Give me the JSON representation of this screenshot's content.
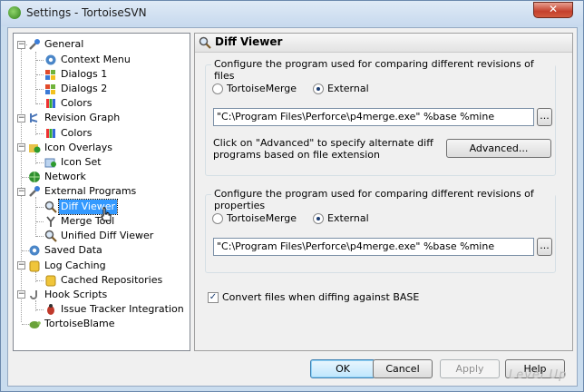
{
  "window": {
    "title": "Settings - TortoiseSVN",
    "close_glyph": "✕"
  },
  "tree": {
    "nodes": [
      {
        "label": "General",
        "icon": "wrench-icon"
      },
      {
        "label": "Context Menu",
        "icon": "gear-icon"
      },
      {
        "label": "Dialogs 1",
        "icon": "windows-flag-icon"
      },
      {
        "label": "Dialogs 2",
        "icon": "windows-flag-icon"
      },
      {
        "label": "Colors",
        "icon": "palette-icon"
      },
      {
        "label": "Revision Graph",
        "icon": "graph-icon"
      },
      {
        "label": "Colors",
        "icon": "palette-icon"
      },
      {
        "label": "Icon Overlays",
        "icon": "overlay-icon"
      },
      {
        "label": "Icon Set",
        "icon": "iconset-icon"
      },
      {
        "label": "Network",
        "icon": "globe-icon"
      },
      {
        "label": "External Programs",
        "icon": "wrench-icon"
      },
      {
        "label": "Diff Viewer",
        "icon": "magnifier-icon"
      },
      {
        "label": "Merge Tool",
        "icon": "merge-icon"
      },
      {
        "label": "Unified Diff Viewer",
        "icon": "magnifier-icon"
      },
      {
        "label": "Saved Data",
        "icon": "gear-icon"
      },
      {
        "label": "Log Caching",
        "icon": "database-icon"
      },
      {
        "label": "Cached Repositories",
        "icon": "database-icon"
      },
      {
        "label": "Hook Scripts",
        "icon": "hook-icon"
      },
      {
        "label": "Issue Tracker Integration",
        "icon": "bug-icon"
      },
      {
        "label": "TortoiseBlame",
        "icon": "tortoise-icon"
      }
    ]
  },
  "panel": {
    "title": "Diff Viewer",
    "files_group": {
      "legend": "Configure the program used for comparing different revisions of files",
      "option_internal": "TortoiseMerge",
      "option_external": "External",
      "selected": "External",
      "command": "\"C:\\Program Files\\Perforce\\p4merge.exe\" %base %mine",
      "browse": "...",
      "advanced_hint": "Click on \"Advanced\" to specify alternate diff programs based on file extension",
      "advanced_button": "Advanced..."
    },
    "props_group": {
      "legend": "Configure the program used for comparing different revisions of properties",
      "option_internal": "TortoiseMerge",
      "option_external": "External",
      "selected": "External",
      "command": "\"C:\\Program Files\\Perforce\\p4merge.exe\" %base %mine",
      "browse": "..."
    },
    "convert_label": "Convert files when diffing against BASE",
    "convert_checked": true,
    "check_glyph": "✓"
  },
  "buttons": {
    "ok": "OK",
    "cancel": "Cancel",
    "apply": "Apply",
    "help": "Help"
  },
  "watermark": "Level Up"
}
